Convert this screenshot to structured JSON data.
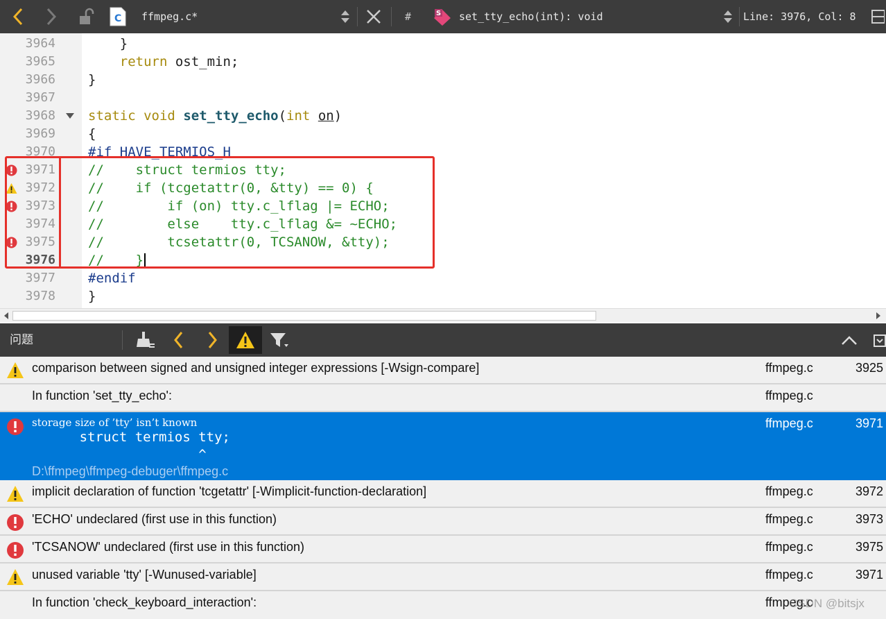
{
  "toolbar": {
    "filename": "ffmpeg.c*",
    "hash_label": "#",
    "function_sig": "set_tty_echo(int): void",
    "position": "Line: 3976, Col: 8"
  },
  "editor": {
    "lines": {
      "l3964": {
        "num": "3964",
        "t1": "    }"
      },
      "l3965": {
        "num": "3965",
        "t1": "    ",
        "kw1": "return",
        "t2": " ost_min;"
      },
      "l3966": {
        "num": "3966",
        "t1": "}"
      },
      "l3967": {
        "num": "3967"
      },
      "l3968": {
        "num": "3968",
        "kw1": "static",
        "t1": " ",
        "kw2": "void",
        "t2": " ",
        "fn": "set_tty_echo",
        "t3": "(",
        "kw3": "int",
        "t4": " ",
        "param": "on",
        "t5": ")"
      },
      "l3969": {
        "num": "3969",
        "t1": "{"
      },
      "l3970": {
        "num": "3970",
        "pp": "#if HAVE_TERMIOS_H"
      },
      "l3971": {
        "num": "3971",
        "cm": "//    struct termios tty;"
      },
      "l3972": {
        "num": "3972",
        "cm": "//    if (tcgetattr(0, &tty) == 0) {"
      },
      "l3973": {
        "num": "3973",
        "cm": "//        if (on) tty.c_lflag |= ECHO;"
      },
      "l3974": {
        "num": "3974",
        "cm": "//        else    tty.c_lflag &= ~ECHO;"
      },
      "l3975": {
        "num": "3975",
        "cm": "//        tcsetattr(0, TCSANOW, &tty);"
      },
      "l3976": {
        "num": "3976",
        "cm": "//    }"
      },
      "l3977": {
        "num": "3977",
        "pp": "#endif"
      },
      "l3978": {
        "num": "3978",
        "t1": "}"
      }
    }
  },
  "problems": {
    "title": "问题",
    "rows": [
      {
        "severity": "warning",
        "message": "comparison between signed and unsigned integer expressions [-Wsign-compare]",
        "file": "ffmpeg.c",
        "line": "3925"
      },
      {
        "severity": "none",
        "message": "In function 'set_tty_echo':",
        "file": "ffmpeg.c",
        "line": ""
      },
      {
        "severity": "error",
        "message": "storage size of ’tty’ isn’t known",
        "code": "      struct termios tty;\n                     ^",
        "path": "D:\\ffmpeg\\ffmpeg-debuger\\ffmpeg.c",
        "file": "ffmpeg.c",
        "line": "3971"
      },
      {
        "severity": "warning",
        "message": "implicit declaration of function 'tcgetattr' [-Wimplicit-function-declaration]",
        "file": "ffmpeg.c",
        "line": "3972"
      },
      {
        "severity": "error",
        "message": "'ECHO' undeclared (first use in this function)",
        "file": "ffmpeg.c",
        "line": "3973"
      },
      {
        "severity": "error",
        "message": "'TCSANOW' undeclared (first use in this function)",
        "file": "ffmpeg.c",
        "line": "3975"
      },
      {
        "severity": "warning",
        "message": "unused variable 'tty' [-Wunused-variable]",
        "file": "ffmpeg.c",
        "line": "3971"
      },
      {
        "severity": "none",
        "message": "In function 'check_keyboard_interaction':",
        "file": "ffmpeg.c",
        "line": ""
      }
    ]
  },
  "watermark": "CSDN @bitsjx",
  "colors": {
    "accent": "#0078d7",
    "error": "#e0393e",
    "warning": "#f5c518",
    "highlight_box": "#e5302a",
    "back_arrow": "#f0b429"
  }
}
